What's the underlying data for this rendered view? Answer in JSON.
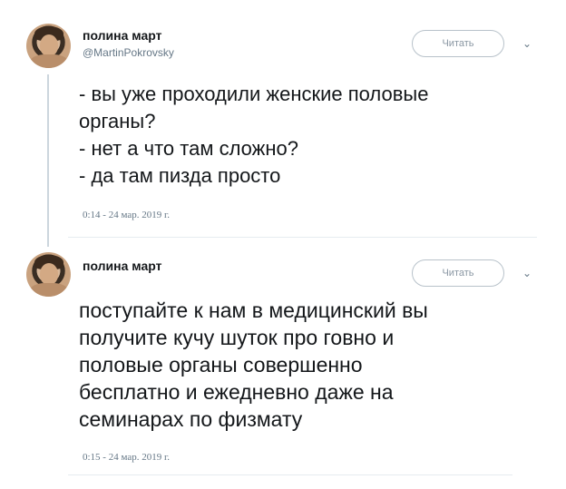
{
  "tweets": [
    {
      "name": "полина март",
      "handle": "@MartinPokrovsky",
      "follow_label": "Читать",
      "lines": [
        "- вы уже проходили женские половые",
        "органы?",
        "- нет а что там сложно?",
        "- да там пизда просто"
      ],
      "timestamp": "0:14 - 24 мар. 2019 г."
    },
    {
      "name": "полина март",
      "follow_label": "Читать",
      "lines": [
        "поступайте к нам в медицинский вы",
        "получите кучу шуток про говно и",
        "половые органы совершенно",
        "бесплатно и ежедневно даже на",
        "семинарах по физмату"
      ],
      "timestamp": "0:15 - 24 мар. 2019 г."
    }
  ],
  "icons": {
    "chevron": "chevron-down-icon"
  }
}
